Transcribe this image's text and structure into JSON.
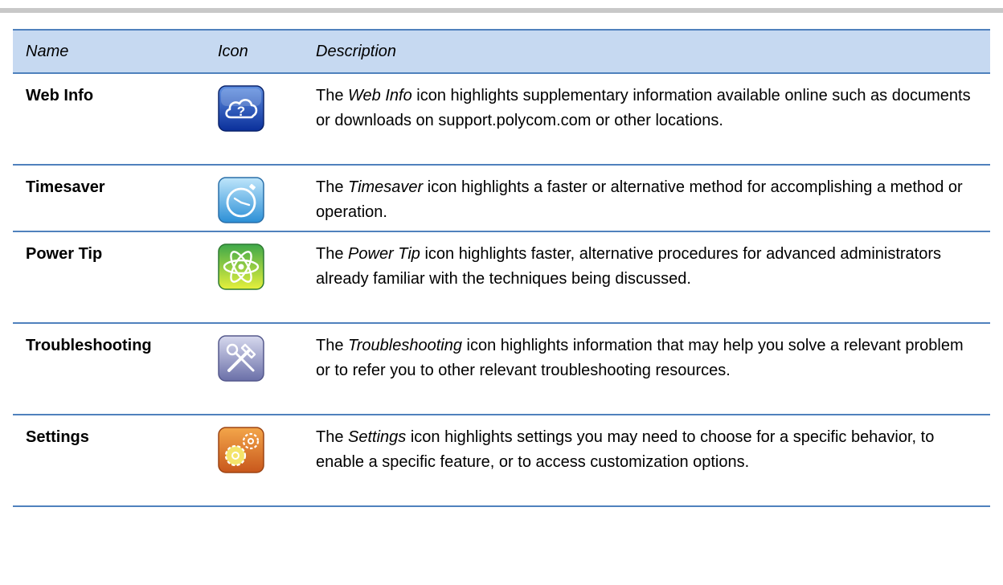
{
  "table": {
    "headers": {
      "name": "Name",
      "icon": "Icon",
      "description": "Description"
    },
    "rows": [
      {
        "name": "Web Info",
        "icon": "cloud-question-icon",
        "desc_pre": "The ",
        "desc_em": "Web Info",
        "desc_post": " icon highlights supplementary information available online such as documents or downloads on support.polycom.com or other locations."
      },
      {
        "name": "Timesaver",
        "icon": "stopwatch-icon",
        "desc_pre": "The ",
        "desc_em": "Timesaver",
        "desc_post": " icon highlights a faster or alternative method for accomplishing a method or operation."
      },
      {
        "name": "Power Tip",
        "icon": "atom-icon",
        "desc_pre": "The ",
        "desc_em": "Power Tip",
        "desc_post": " icon highlights faster, alternative procedures for advanced administrators already familiar with the techniques being discussed."
      },
      {
        "name": "Troubleshooting",
        "icon": "tools-icon",
        "desc_pre": "The ",
        "desc_em": "Troubleshooting",
        "desc_post": " icon highlights information that may help you solve a relevant problem or to refer you to other relevant troubleshooting resources."
      },
      {
        "name": "Settings",
        "icon": "gears-icon",
        "desc_pre": "The ",
        "desc_em": "Settings",
        "desc_post": " icon highlights settings you may need to choose for a specific behavior, to enable a specific feature, or to access customization options."
      }
    ]
  },
  "colors": {
    "header_bg": "#c6d9f1",
    "rule": "#4f81bd",
    "top_bar": "#c8c8c8"
  }
}
